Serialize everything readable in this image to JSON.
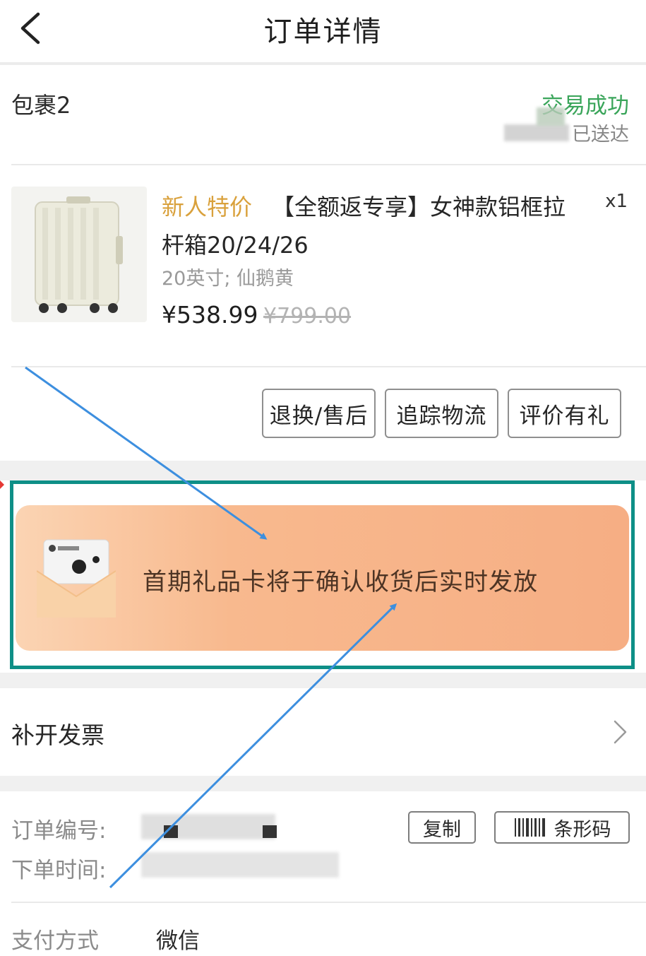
{
  "header": {
    "title": "订单详情",
    "back_icon": "chevron-left-icon"
  },
  "package": {
    "name": "包裹2",
    "status": "交易成功",
    "delivery_status": "已送达"
  },
  "product": {
    "promo_tag": "新人特价",
    "title_line1": "【全额返专享】女神款铝框拉",
    "title_line2": "杆箱20/24/26",
    "quantity": "x1",
    "spec": "20英寸; 仙鹅黄",
    "price": "¥538.99",
    "original_price": "¥799.00"
  },
  "actions": {
    "return_label": "退换/售后",
    "track_label": "追踪物流",
    "review_label": "评价有礼"
  },
  "banner": {
    "text": "首期礼品卡将于确认收货后实时发放"
  },
  "invoice": {
    "label": "补开发票"
  },
  "order_info": {
    "order_no_label": "订单编号:",
    "order_time_label": "下单时间:",
    "copy_label": "复制",
    "barcode_label": "条形码",
    "pay_method_label": "支付方式",
    "pay_method_value": "微信"
  },
  "colors": {
    "status_green": "#3aa55a",
    "promo_gold": "#d9a13c",
    "highlight_teal": "#0e8f87",
    "annotation_blue": "#3d8fdf",
    "banner_orange": "#f6ae84"
  }
}
